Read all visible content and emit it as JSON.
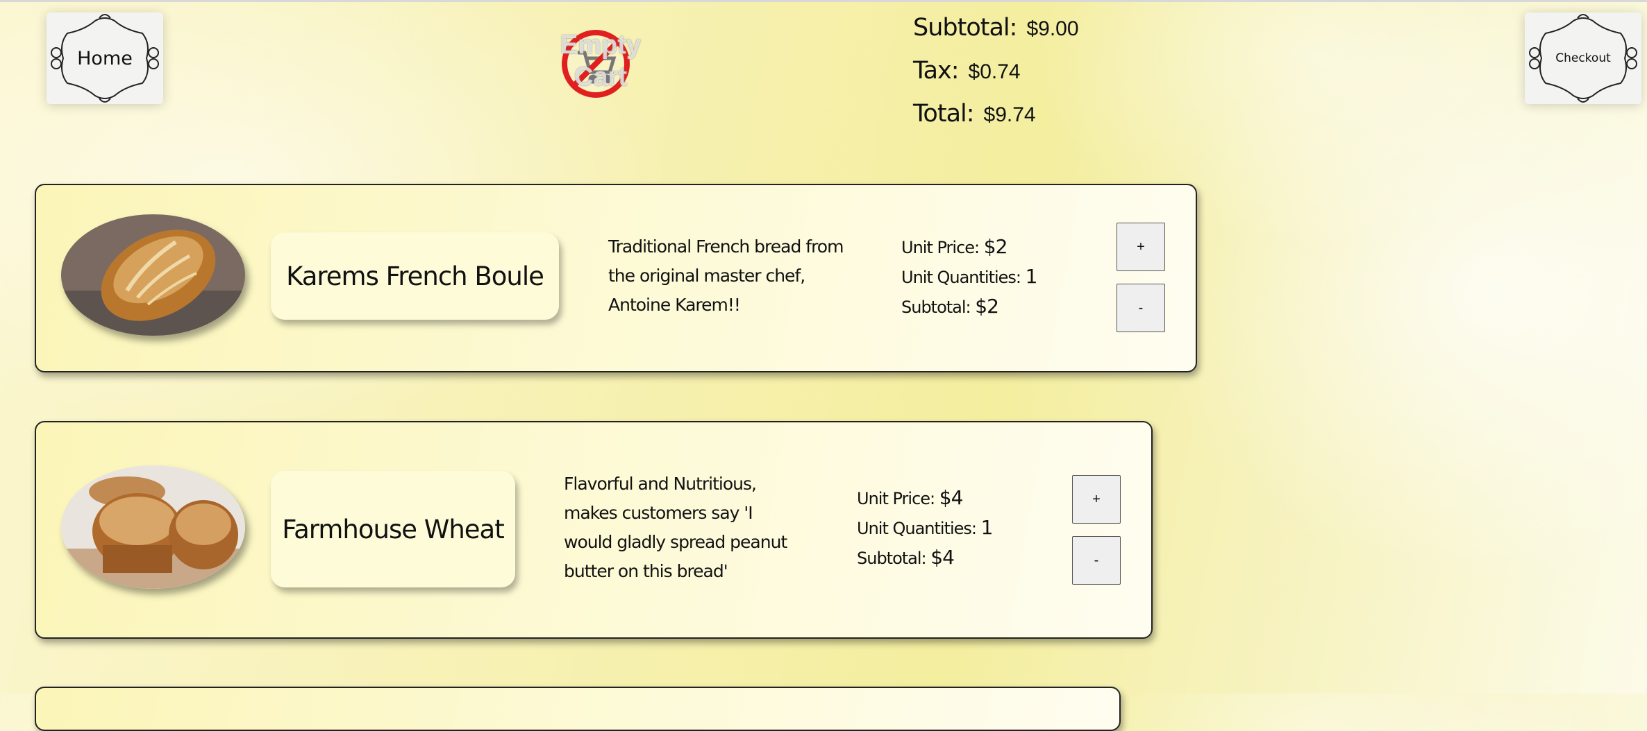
{
  "nav": {
    "home_label": "Home",
    "checkout_label": "Checkout"
  },
  "cart": {
    "empty_line1": "Empty",
    "empty_line2": "Cart",
    "icon": "no-cart-icon"
  },
  "totals": {
    "subtotal_label": "Subtotal:",
    "subtotal_value": "$9.00",
    "tax_label": "Tax:",
    "tax_value": "$0.74",
    "total_label": "Total:",
    "total_value": "$9.74"
  },
  "products": [
    {
      "name": "Karems French Boule",
      "description": [
        "Traditional French bread from",
        "the original master chef,",
        "Antoine Karem!!"
      ],
      "unit_price_label": "Unit Price:",
      "unit_price": "$2",
      "unit_qty_label": "Unit Quantities:",
      "unit_qty": "1",
      "subtotal_label": "Subtotal:",
      "subtotal": "$2",
      "plus_label": "+",
      "minus_label": "-"
    },
    {
      "name": "Farmhouse Wheat",
      "description": [
        "Flavorful and Nutritious,",
        "makes customers say 'I",
        "would gladly spread peanut",
        "butter on this bread'"
      ],
      "unit_price_label": "Unit Price:",
      "unit_price": "$4",
      "unit_qty_label": "Unit Quantities:",
      "unit_qty": "1",
      "subtotal_label": "Subtotal:",
      "subtotal": "$4",
      "plus_label": "+",
      "minus_label": "-"
    }
  ]
}
